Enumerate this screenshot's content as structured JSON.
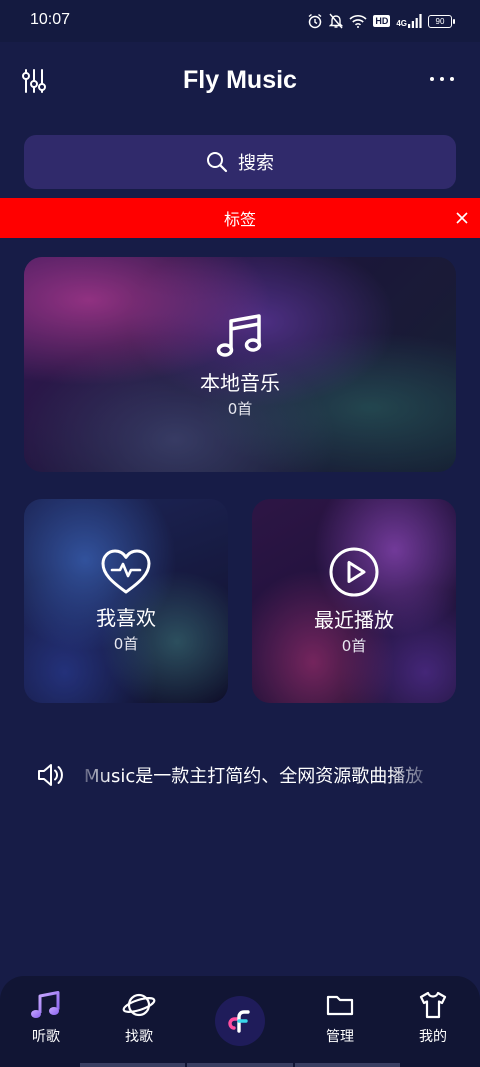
{
  "status_bar": {
    "time": "10:07",
    "network": "4G",
    "hd": "HD",
    "battery": "90"
  },
  "header": {
    "title": "Fly Music",
    "left_icon": "equalizer-icon",
    "right_icon": "more-dots-icon"
  },
  "search": {
    "label": "搜索",
    "icon": "search-icon"
  },
  "notice": {
    "text": "标签",
    "close_icon": "close-icon"
  },
  "cards": {
    "local": {
      "title": "本地音乐",
      "count": "0首",
      "icon": "music-note-icon"
    },
    "favorites": {
      "title": "我喜欢",
      "count": "0首",
      "icon": "heart-pulse-icon"
    },
    "recent": {
      "title": "最近播放",
      "count": "0首",
      "icon": "play-circle-icon"
    }
  },
  "marquee": {
    "icon": "speaker-icon",
    "text": "Music是一款主打简约、全网资源歌曲播放"
  },
  "bottom_nav": {
    "items": [
      {
        "label": "听歌",
        "icon": "music-note-icon"
      },
      {
        "label": "找歌",
        "icon": "planet-icon"
      },
      {
        "label": "",
        "icon": "app-logo-icon"
      },
      {
        "label": "管理",
        "icon": "folder-icon"
      },
      {
        "label": "我的",
        "icon": "tshirt-icon"
      }
    ]
  },
  "colors": {
    "background": "#171c47",
    "search_bg": "#302a6b",
    "notice_bg": "#ff0000",
    "nav_bg": "#111534",
    "accent": "#a58bff"
  }
}
